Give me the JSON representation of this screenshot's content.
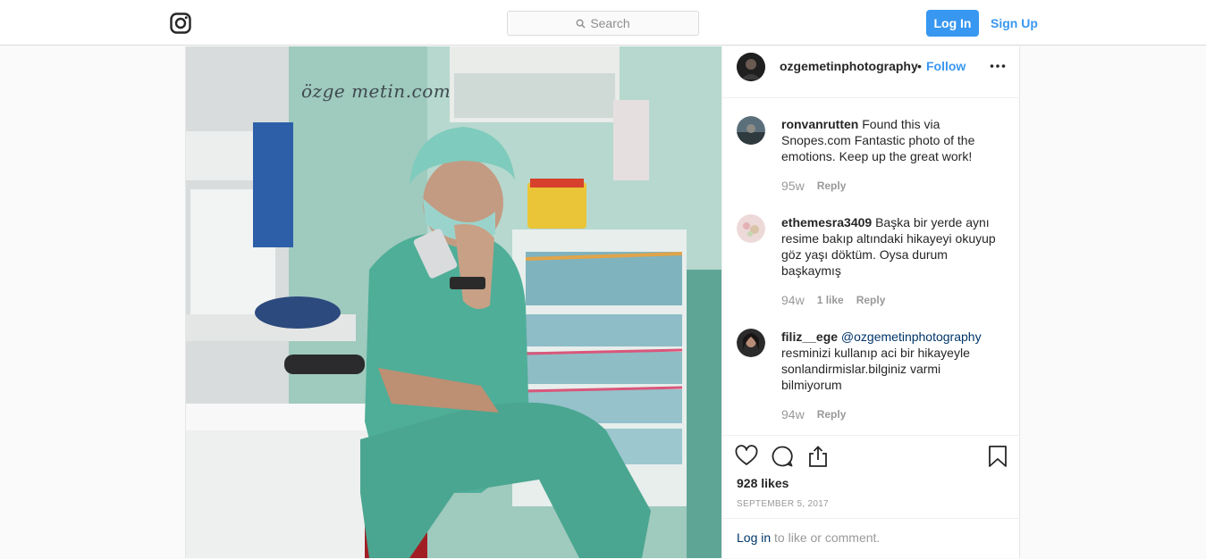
{
  "nav": {
    "search_placeholder": "Search",
    "login_label": "Log In",
    "signup_label": "Sign Up",
    "logo_icon": "instagram-camera-icon"
  },
  "colors": {
    "accent": "#3897f0",
    "mention": "#003569",
    "muted": "#999999",
    "border": "#dbdbdb"
  },
  "post": {
    "image_watermark": "özge metin.com",
    "author": "ozgemetinphotography",
    "separator": "•",
    "follow_label": "Follow",
    "more_icon": "more-options-icon",
    "comments": [
      {
        "user": "ronvanrutten",
        "text": "Found this via Snopes.com Fantastic photo of the emotions. Keep up the great work!",
        "time": "95w",
        "likes": "",
        "reply": "Reply"
      },
      {
        "user": "ethemesra3409",
        "text": "Başka bir yerde aynı resime bakıp altındaki hikayeyi okuyup göz yaşı döktüm. Oysa durum başkaymış",
        "time": "94w",
        "likes": "1 like",
        "reply": "Reply"
      },
      {
        "user": "filiz__ege",
        "mention": "@ozgemetinphotography",
        "text": "resminizi kullanıp aci bir hikayeyle sonlandirmislar.bilginiz varmi bilmiyorum",
        "time": "94w",
        "likes": "",
        "reply": "Reply"
      }
    ],
    "likes": "928 likes",
    "date": "SEPTEMBER 5, 2017",
    "login_prompt": {
      "link": "Log in",
      "rest": " to like or comment."
    }
  }
}
